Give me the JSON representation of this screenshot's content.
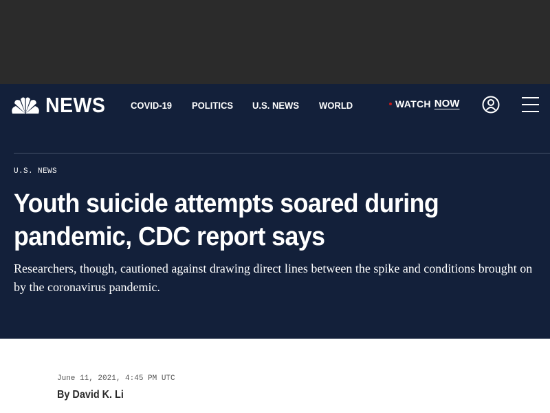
{
  "header": {
    "logo_text": "NEWS",
    "nav": [
      "COVID-19",
      "POLITICS",
      "U.S. NEWS",
      "WORLD"
    ],
    "watch_label": "WATCH",
    "watch_now": "NOW"
  },
  "article": {
    "section": "U.S. NEWS",
    "headline": "Youth suicide attempts soared during pandemic, CDC report says",
    "dek": "Researchers, though, cautioned against drawing direct lines between the spike and conditions brought on by the coronavirus pandemic.",
    "timestamp": "June 11, 2021, 4:45 PM UTC",
    "byline_prefix": "By",
    "author": "David K. Li"
  },
  "colors": {
    "header_bg": "#13203a",
    "ad_bg": "#2b2b2b",
    "live_dot": "#c41a1a"
  },
  "icons": [
    "nbc-peacock-icon",
    "live-dot-icon",
    "account-icon",
    "hamburger-menu-icon"
  ]
}
